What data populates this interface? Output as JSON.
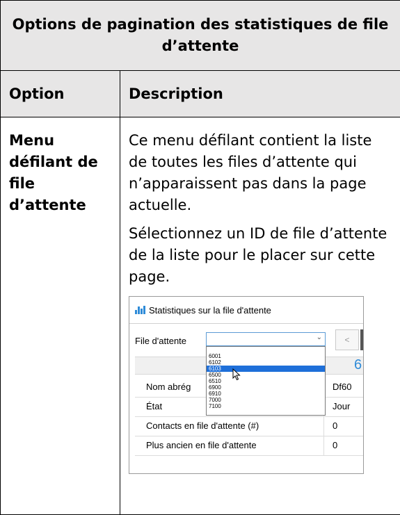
{
  "table": {
    "title": "Options de pagination des statistiques de file d’attente",
    "header_option": "Option",
    "header_description": "Description",
    "option_name": "Menu défilant de file d’attente",
    "description_p1": "Ce menu défilant contient la liste de toutes les files d’attente qui n’apparaissent pas dans la page actuelle.",
    "description_p2": "Sélectionnez un ID de file d’attente de la liste pour le placer sur cette page."
  },
  "widget": {
    "title": "Statistiques sur la file d'attente",
    "queue_label": "File d'attente",
    "select_value": "",
    "prev_label": "<",
    "column_value": "6",
    "dropdown_options": [
      "6001",
      "6102",
      "6103",
      "6500",
      "6510",
      "6900",
      "6910",
      "7000",
      "7100"
    ],
    "selected_option": "6103",
    "rows": [
      {
        "label": "Nom abrég",
        "value": "Df60"
      },
      {
        "label": "État",
        "value": "Jour"
      },
      {
        "label": "Contacts en file d'attente (#)",
        "value": "0"
      },
      {
        "label": "Plus ancien en file d'attente",
        "value": "0"
      }
    ],
    "colors": {
      "accent": "#2e8bd8",
      "selection": "#1e6fd9",
      "header_bg": "#e7e6e6"
    }
  }
}
